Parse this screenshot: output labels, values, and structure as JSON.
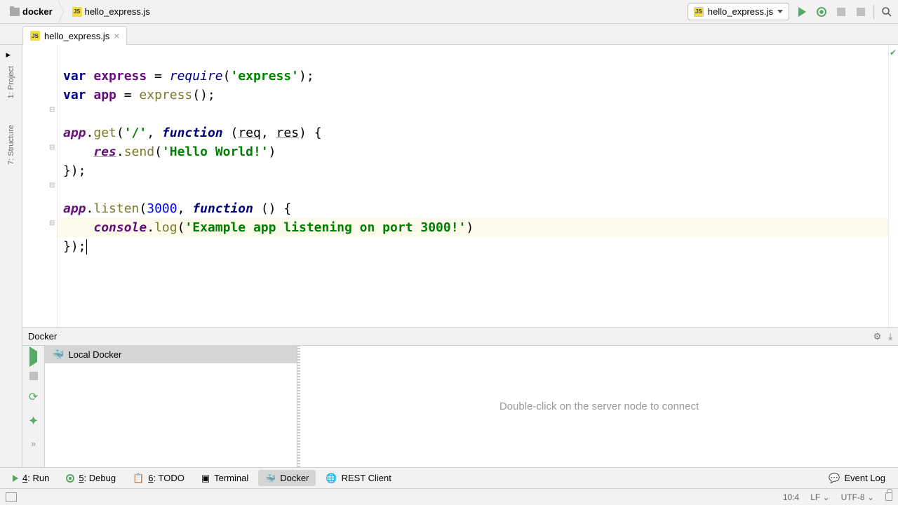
{
  "breadcrumbs": {
    "folder": "docker",
    "file": "hello_express.js"
  },
  "run_config": {
    "name": "hello_express.js"
  },
  "file_tab": {
    "name": "hello_express.js"
  },
  "left_tools": {
    "project": "1: Project",
    "structure": "7: Structure"
  },
  "code": {
    "l1_var": "var",
    "l1_express": "express",
    "l1_eq": " = ",
    "l1_require": "require",
    "l1_open": "(",
    "l1_str": "'express'",
    "l1_close": ");",
    "l2_var": "var",
    "l2_app": "app",
    "l2_eq": " = ",
    "l2_express": "express",
    "l2_call": "();",
    "l4_app": "app",
    "l4_dot": ".",
    "l4_get": "get",
    "l4_open": "(",
    "l4_str": "'/'",
    "l4_comma": ", ",
    "l4_func": "function",
    "l4_paren": " (",
    "l4_req": "req",
    "l4_c2": ", ",
    "l4_res": "res",
    "l4_end": ") {",
    "l5_indent": "    ",
    "l5_res": "res",
    "l5_dot": ".",
    "l5_send": "send",
    "l5_open": "(",
    "l5_str": "'Hello World!'",
    "l5_close": ")",
    "l6": "});",
    "l8_app": "app",
    "l8_dot": ".",
    "l8_listen": "listen",
    "l8_open": "(",
    "l8_num": "3000",
    "l8_comma": ", ",
    "l8_func": "function",
    "l8_end": " () {",
    "l9_indent": "    ",
    "l9_console": "console",
    "l9_dot": ".",
    "l9_log": "log",
    "l9_open": "(",
    "l9_str": "'Example app listening on port 3000!'",
    "l9_close": ")",
    "l10": "});"
  },
  "docker": {
    "title": "Docker",
    "tree_item": "Local Docker",
    "hint": "Double-click on the server node to connect"
  },
  "bottom_tabs": {
    "run": "4: Run",
    "debug": "5: Debug",
    "todo": "6: TODO",
    "terminal": "Terminal",
    "docker": "Docker",
    "rest": "REST Client",
    "event_log": "Event Log"
  },
  "status": {
    "pos": "10:4",
    "le": "LF",
    "enc": "UTF-8"
  }
}
